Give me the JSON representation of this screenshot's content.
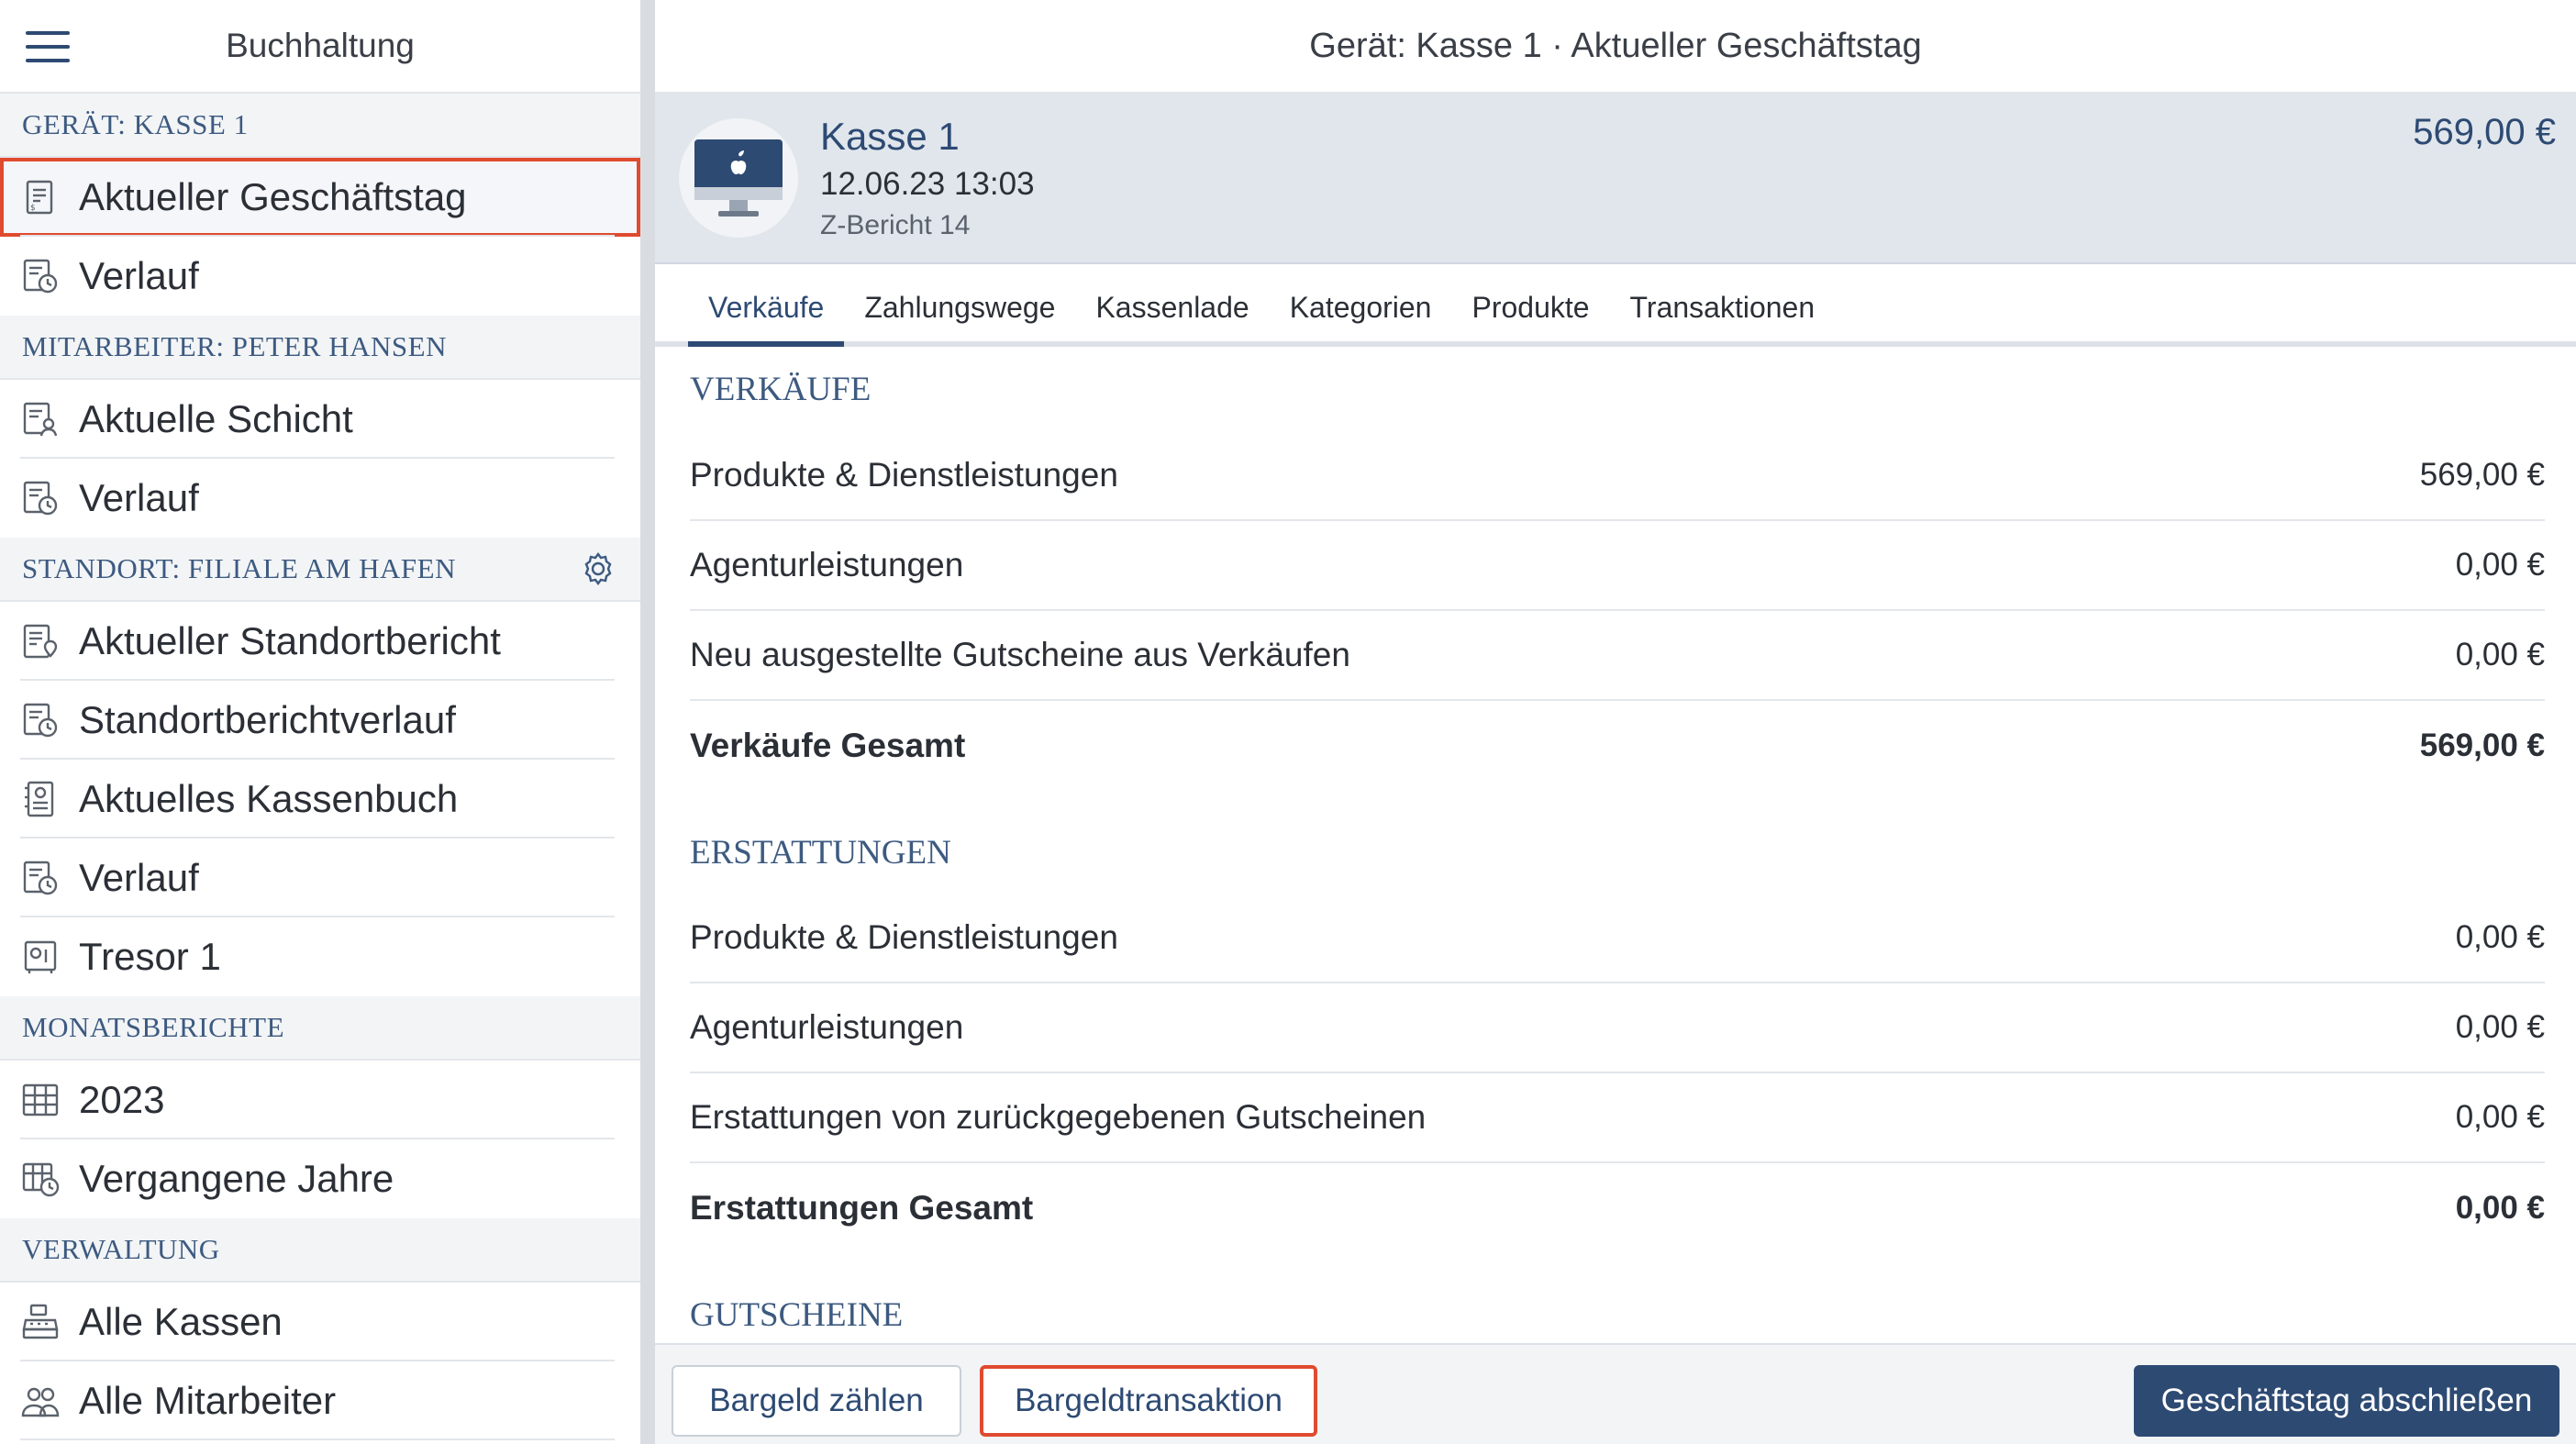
{
  "sidebar": {
    "title": "Buchhaltung",
    "sections": [
      {
        "label": "GERÄT: KASSE 1",
        "items": [
          {
            "label": "Aktueller Geschäftstag",
            "icon": "receipt-icon"
          },
          {
            "label": "Verlauf",
            "icon": "receipt-clock-icon"
          }
        ]
      },
      {
        "label": "MITARBEITER: PETER HANSEN",
        "items": [
          {
            "label": "Aktuelle Schicht",
            "icon": "shift-report-icon"
          },
          {
            "label": "Verlauf",
            "icon": "receipt-clock-icon"
          }
        ]
      },
      {
        "label": "STANDORT: FILIALE AM HAFEN",
        "items": [
          {
            "label": "Aktueller Standortbericht",
            "icon": "location-report-icon"
          },
          {
            "label": "Standortberichtverlauf",
            "icon": "receipt-clock-icon"
          },
          {
            "label": "Aktuelles Kassenbuch",
            "icon": "cashbook-icon"
          },
          {
            "label": "Verlauf",
            "icon": "receipt-clock-icon"
          },
          {
            "label": "Tresor 1",
            "icon": "safe-icon"
          }
        ]
      },
      {
        "label": "MONATSBERICHTE",
        "items": [
          {
            "label": "2023",
            "icon": "calendar-icon"
          },
          {
            "label": "Vergangene Jahre",
            "icon": "calendar-clock-icon"
          }
        ]
      },
      {
        "label": "VERWALTUNG",
        "items": [
          {
            "label": "Alle Kassen",
            "icon": "cash-register-icon"
          },
          {
            "label": "Alle Mitarbeiter",
            "icon": "users-icon"
          }
        ]
      }
    ]
  },
  "main": {
    "title": "Gerät: Kasse 1 · Aktueller Geschäftstag",
    "device": {
      "name": "Kasse 1",
      "date": "12.06.23 13:03",
      "report": "Z-Bericht 14",
      "total": "569,00 €"
    },
    "tabs": [
      "Verkäufe",
      "Zahlungswege",
      "Kassenlade",
      "Kategorien",
      "Produkte",
      "Transaktionen"
    ],
    "groups": [
      {
        "title": "VERKÄUFE",
        "rows": [
          {
            "label": "Produkte & Dienstleistungen",
            "value": "569,00 €"
          },
          {
            "label": "Agenturleistungen",
            "value": "0,00 €"
          },
          {
            "label": "Neu ausgestellte Gutscheine aus Verkäufen",
            "value": "0,00 €"
          }
        ],
        "total": {
          "label": "Verkäufe Gesamt",
          "value": "569,00 €"
        }
      },
      {
        "title": "ERSTATTUNGEN",
        "rows": [
          {
            "label": "Produkte & Dienstleistungen",
            "value": "0,00 €"
          },
          {
            "label": "Agenturleistungen",
            "value": "0,00 €"
          },
          {
            "label": "Erstattungen von zurückgegebenen Gutscheinen",
            "value": "0,00 €"
          }
        ],
        "total": {
          "label": "Erstattungen Gesamt",
          "value": "0,00 €"
        }
      },
      {
        "title": "GUTSCHEINE"
      }
    ],
    "footer": {
      "count_label": "Bargeld zählen",
      "transaction_label": "Bargeldtransaktion",
      "close_label": "Geschäftstag abschließen"
    }
  },
  "colors": {
    "accent": "#2d4a73",
    "highlight": "#e04a2f",
    "section_bg": "#f2f4f6",
    "card_bg": "#e1e6ec"
  }
}
